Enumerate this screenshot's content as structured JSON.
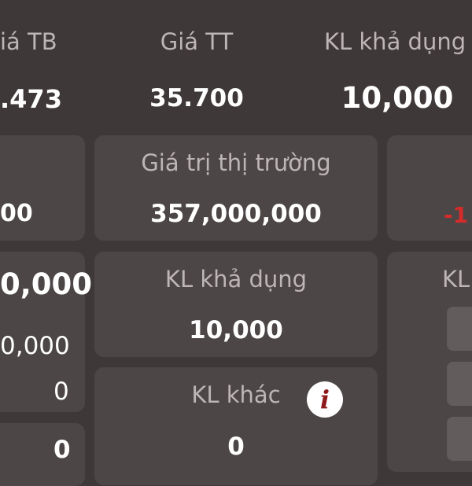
{
  "header": {
    "col1_label": "iá TB",
    "col1_value": ".473",
    "col2_label": "Giá TT",
    "col2_value": "35.700",
    "col3_label": "KL khả dụng",
    "col3_value": "10,000"
  },
  "row1": {
    "left_value": "00",
    "market_value_label": "Giá trị thị trường",
    "market_value": "357,000,000",
    "right_value": "-1"
  },
  "row2": {
    "left_value_big": "0,000",
    "left_value_small": "0,000",
    "left_value_zero": "0",
    "available_label": "KL khả dụng",
    "available_value": "10,000",
    "right_label": "KL"
  },
  "row3": {
    "left_value": "0",
    "other_label": "KL khác",
    "other_value": "0",
    "info_icon_glyph": "i"
  },
  "colors": {
    "background": "#3f3838",
    "card": "#4d4646",
    "label": "#bdb6b6",
    "negative": "#d62b2b",
    "info_icon_bg": "#ffffff",
    "info_icon_fg": "#8e1b1b"
  }
}
